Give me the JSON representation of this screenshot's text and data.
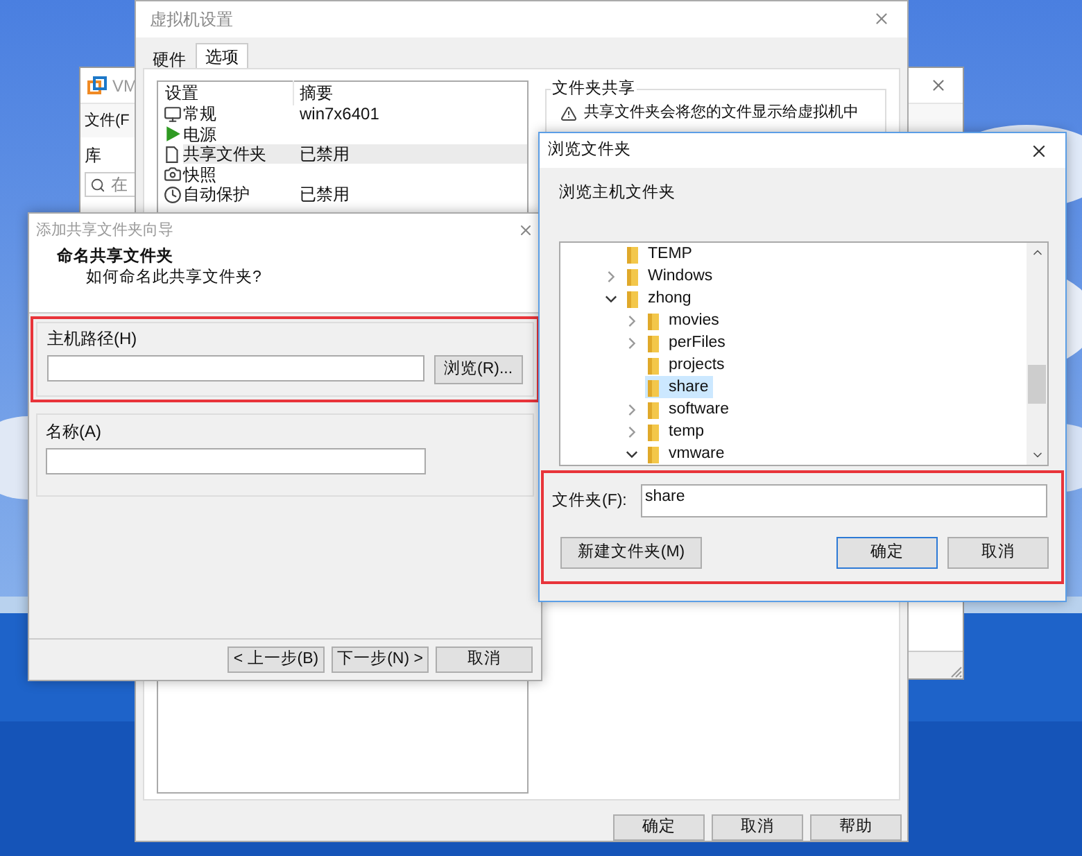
{
  "main_window": {
    "title": "VM",
    "menu": [
      "文件(F"
    ],
    "library_label": "库",
    "search": {
      "placeholder": "在"
    }
  },
  "settings_window": {
    "title": "虚拟机设置",
    "tabs": [
      {
        "label": "硬件",
        "selected": false
      },
      {
        "label": "选项",
        "selected": true
      }
    ],
    "list": {
      "columns": [
        "设置",
        "摘要"
      ],
      "rows": [
        {
          "name": "常规",
          "summary": "win7x6401",
          "selected": false
        },
        {
          "name": "电源",
          "selected": false
        },
        {
          "name": "共享文件夹",
          "summary": "已禁用",
          "selected": true
        },
        {
          "name": "快照",
          "selected": false
        },
        {
          "name": "自动保护",
          "summary": "已禁用",
          "selected": false
        }
      ]
    },
    "group": {
      "title": "文件夹共享",
      "warning": "共享文件夹会将您的文件显示给虚拟机中"
    },
    "buttons": [
      "确定",
      "取消",
      "帮助"
    ]
  },
  "wizard": {
    "title": "添加共享文件夹向导",
    "heading": "命名共享文件夹",
    "subheading": "如何命名此共享文件夹?",
    "host_path": {
      "label": "主机路径(H)",
      "browse": "浏览(R)...",
      "highlighted": true
    },
    "name": {
      "label": "名称(A)"
    },
    "buttons": [
      "< 上一步(B)",
      "下一步(N) >",
      "取消"
    ]
  },
  "browse_dialog": {
    "title": "浏览文件夹",
    "prompt": "浏览主机文件夹",
    "tree": [
      {
        "label": "TEMP",
        "selected": false
      },
      {
        "label": "Windows",
        "expanded": false,
        "selected": false
      },
      {
        "label": "zhong",
        "expanded": true,
        "selected": false,
        "children": [
          {
            "label": "movies",
            "expanded": false,
            "selected": false
          },
          {
            "label": "perFiles",
            "expanded": false,
            "selected": false
          },
          {
            "label": "projects",
            "selected": false
          },
          {
            "label": "share",
            "selected": true
          },
          {
            "label": "software",
            "expanded": false,
            "selected": false
          },
          {
            "label": "temp",
            "expanded": false,
            "selected": false
          },
          {
            "label": "vmware",
            "expanded": true,
            "selected": false
          }
        ]
      }
    ],
    "folder": {
      "label": "文件夹(F):",
      "value": "share"
    },
    "highlighted": true,
    "new_folder": "新建文件夹(M)",
    "buttons": [
      {
        "label": "确定",
        "default": true
      },
      {
        "label": "取消",
        "default": false
      }
    ]
  }
}
